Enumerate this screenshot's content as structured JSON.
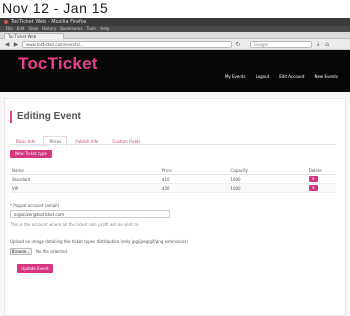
{
  "caption": "Nov 12 - Jan 15",
  "browser": {
    "title": "TocTicket Web - Mozilla Firefox",
    "menu": [
      "File",
      "Edit",
      "View",
      "History",
      "Bookmarks",
      "Tools",
      "Help"
    ],
    "tab_label": "TocTicket Web",
    "url": "www.tocticket.com/events/...",
    "search_placeholder": "Google"
  },
  "site": {
    "logo": "TocTicket",
    "nav": [
      "My Events",
      "Logout",
      "Edit Account",
      "New Events"
    ]
  },
  "page": {
    "title": "Editing Event",
    "tabs": [
      "Basic Info",
      "Prices",
      "Publish Info",
      "Custom Fields"
    ],
    "active_tab": "Prices",
    "new_ticket_button": "New Ticket type",
    "table": {
      "headers": [
        "Name",
        "Price",
        "Capacity",
        "Delete"
      ],
      "rows": [
        {
          "name": "Standard",
          "price": "$10",
          "capacity": "1000"
        },
        {
          "name": "VIP",
          "price": "$50",
          "capacity": "1000"
        }
      ]
    },
    "payment_label": "* Paypal account (email)",
    "payment_value": "organizer@tocticket.com",
    "payment_help": "This is the account where all the ticket sale profit will be sent to.",
    "upload_label": "Upload an image detailing the ticket types distribution (only jpg/jpeg/gif/png extensions)",
    "browse_button": "Browse...",
    "no_file_text": "No file selected.",
    "update_button": "Update Event"
  }
}
